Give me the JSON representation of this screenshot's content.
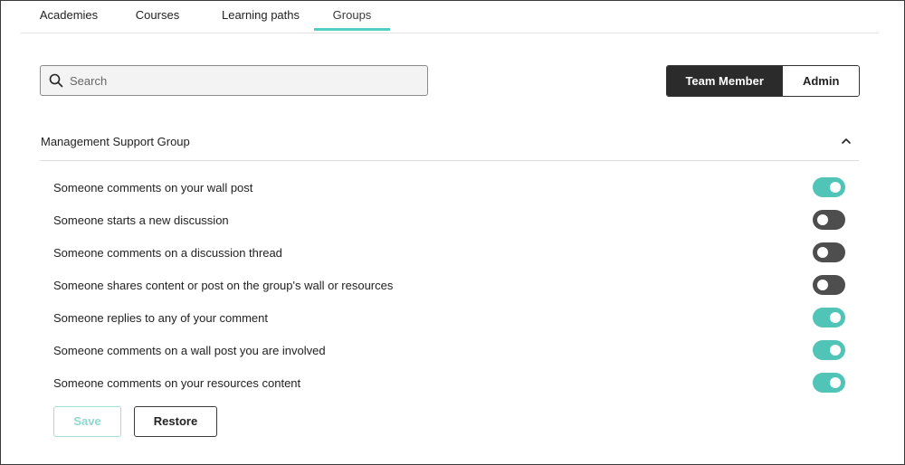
{
  "tabs": [
    {
      "label": "Academies",
      "active": false
    },
    {
      "label": "Courses",
      "active": false
    },
    {
      "label": "Learning paths",
      "active": false
    },
    {
      "label": "Groups",
      "active": true
    }
  ],
  "search": {
    "placeholder": "Search",
    "value": "",
    "icon": "search-icon"
  },
  "roles": {
    "team_member": "Team Member",
    "admin": "Admin",
    "selected": "Team Member"
  },
  "group": {
    "title": "Management Support Group",
    "expanded": true,
    "icon": "chevron-up-icon"
  },
  "notifications": [
    {
      "label": "Someone comments on your wall post",
      "enabled": true
    },
    {
      "label": "Someone starts a new discussion",
      "enabled": false
    },
    {
      "label": "Someone comments on a discussion thread",
      "enabled": false
    },
    {
      "label": "Someone shares content or post on the group's wall or resources",
      "enabled": false
    },
    {
      "label": "Someone replies to any of your comment",
      "enabled": true
    },
    {
      "label": "Someone comments on a wall post you are involved",
      "enabled": true
    },
    {
      "label": "Someone comments on your resources content",
      "enabled": true
    }
  ],
  "actions": {
    "save_label": "Save",
    "restore_label": "Restore"
  },
  "colors": {
    "accent": "#50c4b7",
    "toggle_off": "#4e4e4e",
    "selected_role_bg": "#2b2b2b",
    "tab_underline": "#50cfc2"
  }
}
